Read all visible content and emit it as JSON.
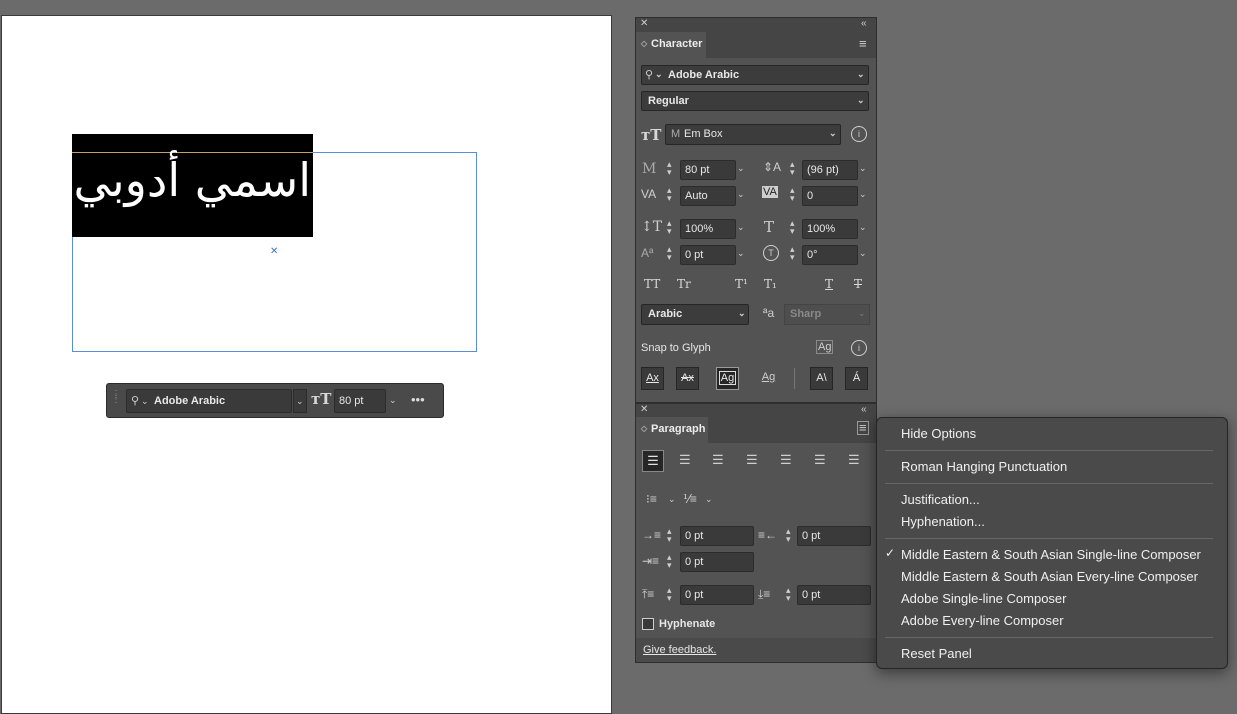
{
  "canvas": {
    "arabic_text": "اسمي أدوبي"
  },
  "context_bar": {
    "font_family": "Adobe Arabic",
    "font_size": "80 pt",
    "more_label": "•••"
  },
  "character_panel": {
    "tab_label": "Character",
    "font_family": "Adobe Arabic",
    "font_style": "Regular",
    "em_box": "Em Box",
    "size": "80 pt",
    "leading": "(96 pt)",
    "kerning": "Auto",
    "tracking": "0",
    "vertical_scale": "100%",
    "horizontal_scale": "100%",
    "baseline_shift": "0 pt",
    "rotation": "0°",
    "language": "Arabic",
    "anti_alias": "Sharp",
    "snap_to_glyph": "Snap to Glyph",
    "style_buttons": [
      "TT",
      "Tr",
      "T¹",
      "T₁",
      "T",
      "T"
    ]
  },
  "paragraph_panel": {
    "tab_label": "Paragraph",
    "indent_left": "0 pt",
    "indent_right": "0 pt",
    "first_line": "0 pt",
    "space_before": "0 pt",
    "space_after": "0 pt",
    "hyphenate_label": "Hyphenate",
    "feedback_link": "Give feedback."
  },
  "flyout_menu": {
    "items": [
      "Hide Options",
      "Roman Hanging Punctuation",
      "Justification...",
      "Hyphenation...",
      "Middle Eastern & South Asian Single-line Composer",
      "Middle Eastern & South Asian Every-line Composer",
      "Adobe Single-line Composer",
      "Adobe Every-line Composer",
      "Reset Panel"
    ],
    "checkmark": "✓"
  }
}
